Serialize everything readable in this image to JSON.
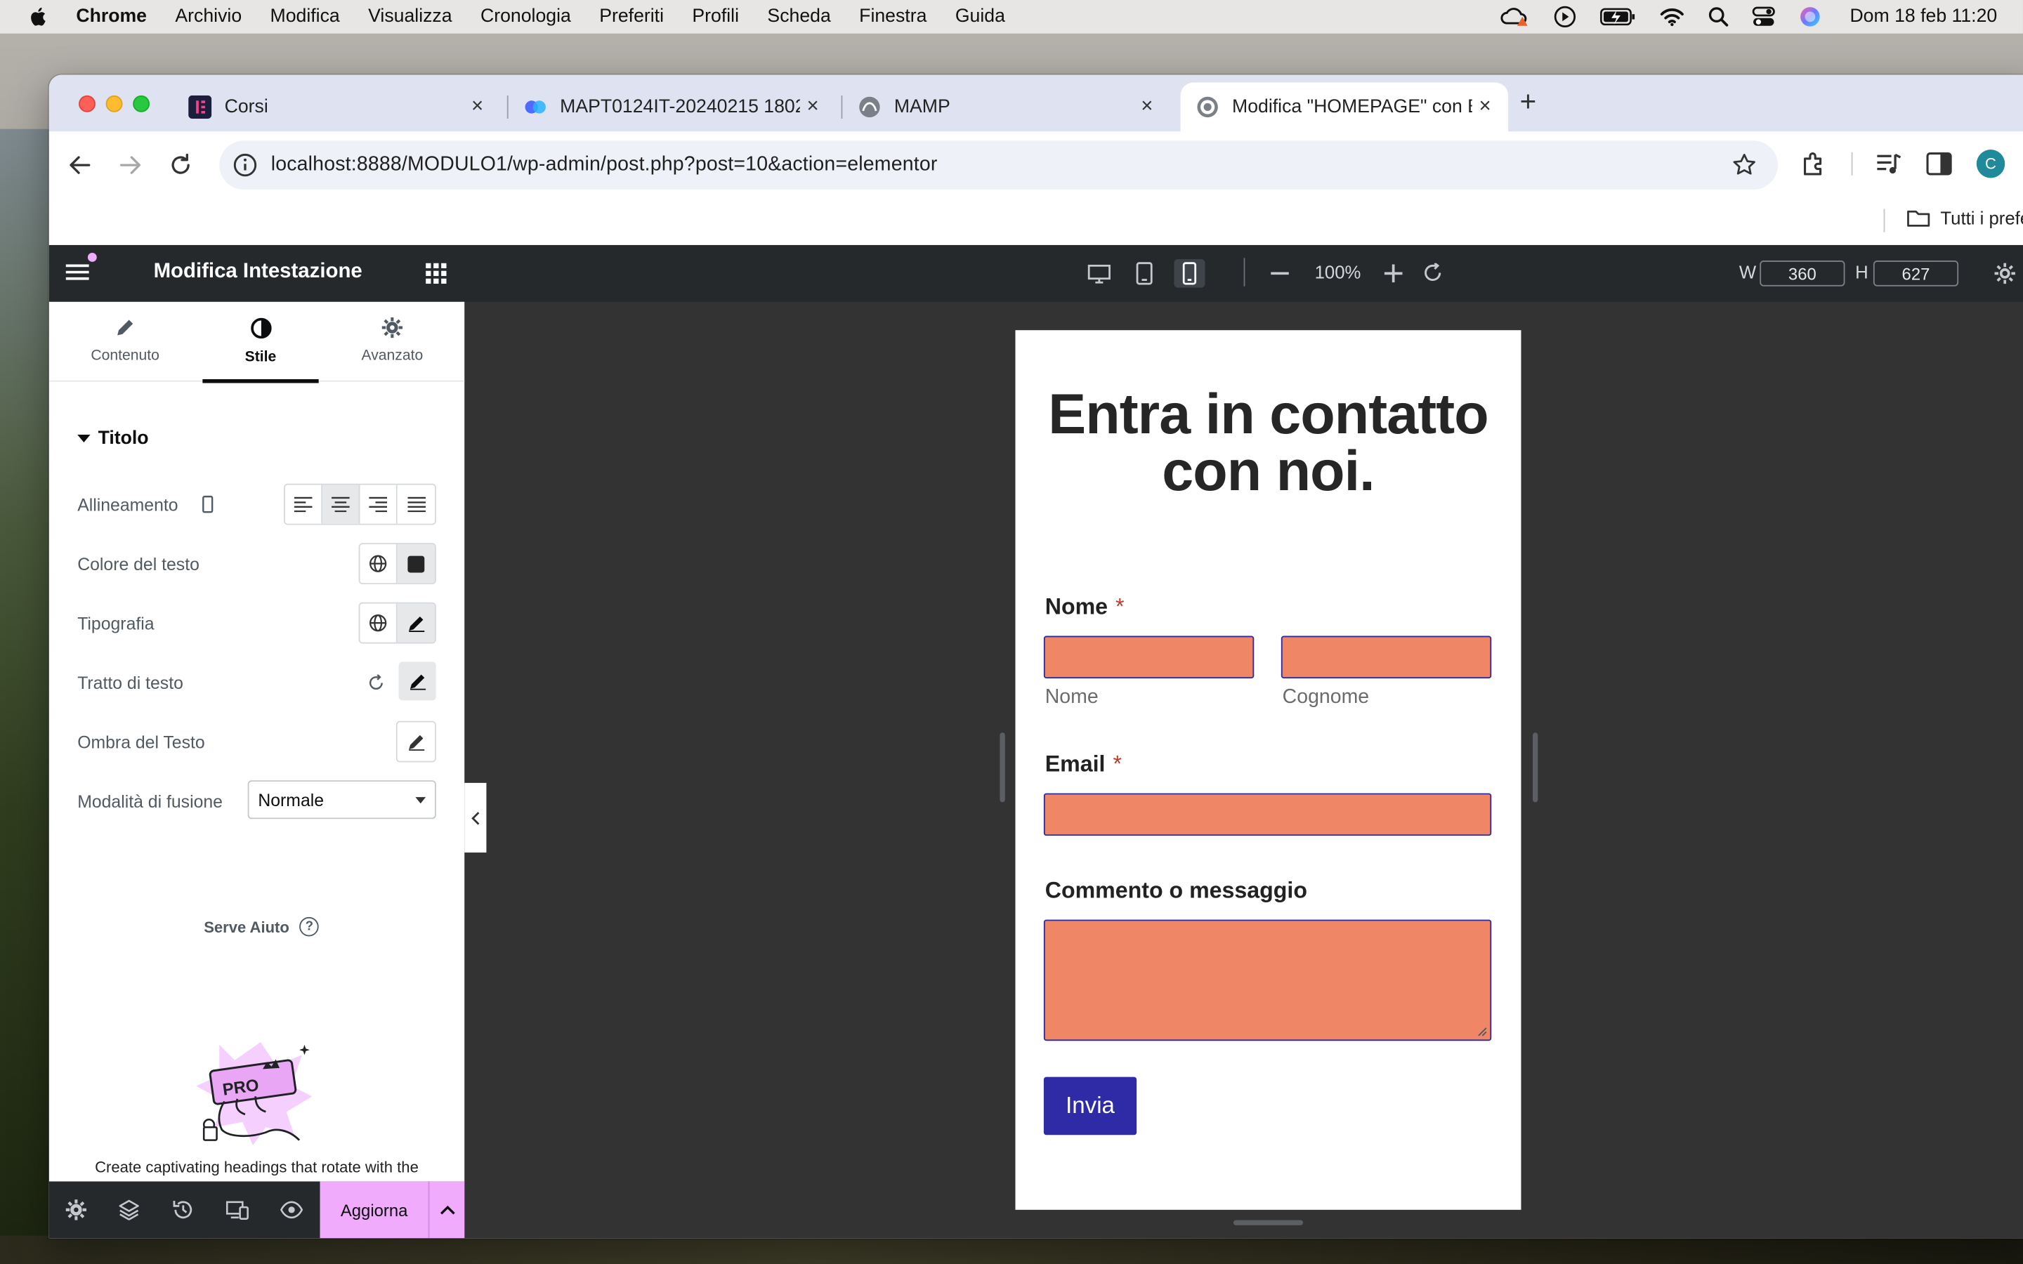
{
  "menubar": {
    "items": [
      "Chrome",
      "Archivio",
      "Modifica",
      "Visualizza",
      "Cronologia",
      "Preferiti",
      "Profili",
      "Scheda",
      "Finestra",
      "Guida"
    ],
    "clock": "Dom 18 feb  11:20"
  },
  "tabs": [
    {
      "title": "Corsi",
      "favicon": "elementor-icon"
    },
    {
      "title": "MAPT0124IT-20240215 1802",
      "favicon": "meeting-icon"
    },
    {
      "title": "MAMP",
      "favicon": "mamp-icon"
    },
    {
      "title": "Modifica \"HOMEPAGE\" con E",
      "favicon": "wordpress-icon"
    }
  ],
  "toolbar": {
    "url": "localhost:8888/MODULO1/wp-admin/post.php?post=10&action=elementor",
    "avatar_letter": "C"
  },
  "bookmarks": {
    "all_bookmarks": "Tutti i prefe"
  },
  "editor": {
    "panel_title": "Modifica Intestazione",
    "zoom": "100%",
    "width_label": "W",
    "width_value": "360",
    "height_label": "H",
    "height_value": "627",
    "panel_tabs": [
      "Contenuto",
      "Stile",
      "Avanzato"
    ],
    "section_title": "Titolo",
    "controls": {
      "alignment": "Allineamento",
      "text_color": "Colore del testo",
      "typography": "Tipografia",
      "text_stroke": "Tratto di testo",
      "text_shadow": "Ombra del Testo",
      "blend_mode": "Modalità di fusione",
      "blend_value": "Normale"
    },
    "help": "Serve Aiuto",
    "promo_text": "Create captivating headings that rotate with the",
    "publish": "Aggiorna",
    "accent_color": "#f0abfc"
  },
  "form": {
    "title_line1": "Entra in contatto",
    "title_line2": "con noi.",
    "name_label": "Nome",
    "required_mark": "*",
    "first_sub": "Nome",
    "last_sub": "Cognome",
    "email_label": "Email",
    "message_label": "Commento o messaggio",
    "submit": "Invia",
    "field_color": "#ef8767",
    "button_color": "#2f2ba6"
  }
}
